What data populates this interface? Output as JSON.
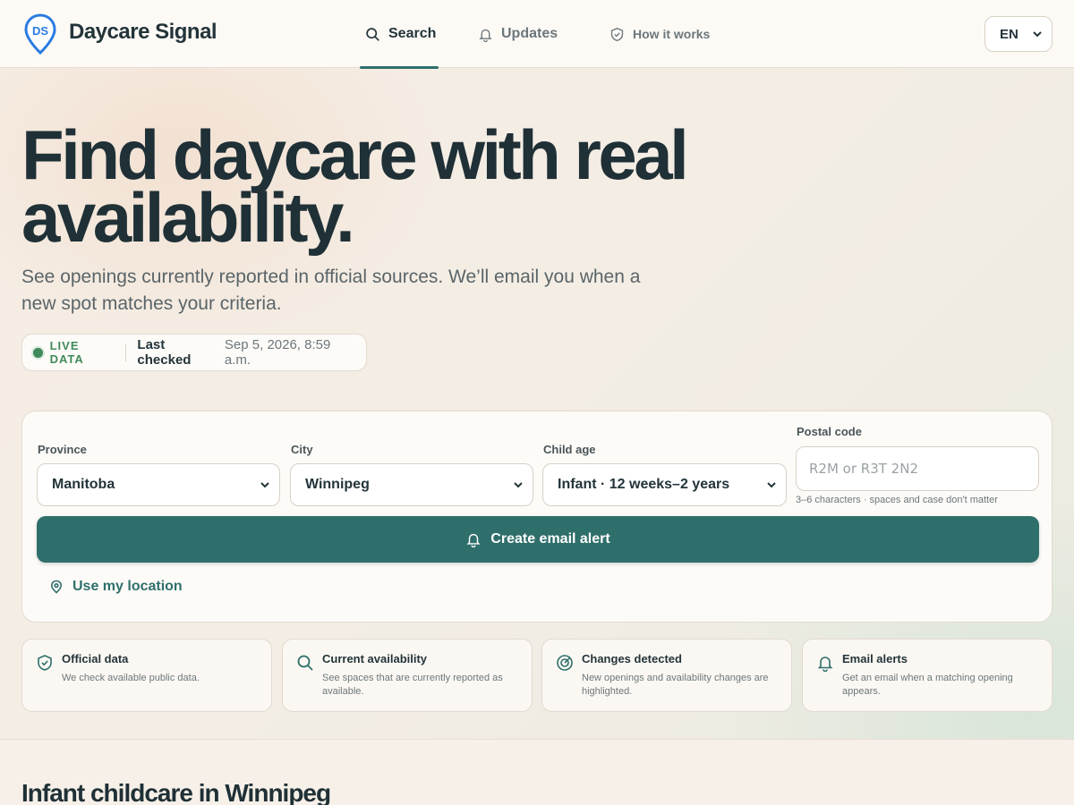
{
  "colors": {
    "brand": "#2f6f6b",
    "live": "#3f8a5a",
    "ink": "#1f3036"
  },
  "header": {
    "logo_text": "DS",
    "brand": "Daycare Signal",
    "nav": [
      {
        "label": "Search",
        "icon": "search-icon",
        "active": true
      },
      {
        "label": "Updates",
        "icon": "bell-icon",
        "active": false
      },
      {
        "label": "How it works",
        "icon": "shield-check-icon",
        "active": false
      }
    ],
    "language": "EN"
  },
  "hero": {
    "title_line1": "Find daycare with real",
    "title_line2": "availability.",
    "subtitle": "See openings currently reported in official sources. We’ll email you when a new spot matches your criteria.",
    "status": {
      "live_label": "LIVE DATA",
      "last_checked_label": "Last checked",
      "last_checked_value": "Sep 5, 2026, 8:59 a.m."
    }
  },
  "search": {
    "province": {
      "label": "Province",
      "value": "Manitoba"
    },
    "city": {
      "label": "City",
      "value": "Winnipeg"
    },
    "child_age": {
      "label": "Child age",
      "value": "Infant · 12 weeks–2 years"
    },
    "postal": {
      "label": "Postal code",
      "placeholder": "R2M or R3T 2N2",
      "hint": "3–6 characters · spaces and case don't matter"
    },
    "cta": "Create email alert",
    "use_location": "Use my location"
  },
  "features": [
    {
      "icon": "shield-check-icon",
      "title": "Official data",
      "desc": "We check available public data."
    },
    {
      "icon": "search-icon",
      "title": "Current availability",
      "desc": "See spaces that are currently reported as available."
    },
    {
      "icon": "target-icon",
      "title": "Changes detected",
      "desc": "New openings and availability changes are highlighted."
    },
    {
      "icon": "bell-icon",
      "title": "Email alerts",
      "desc": "Get an email when a matching opening appears."
    }
  ],
  "results": {
    "title": "Infant childcare in Winnipeg"
  }
}
